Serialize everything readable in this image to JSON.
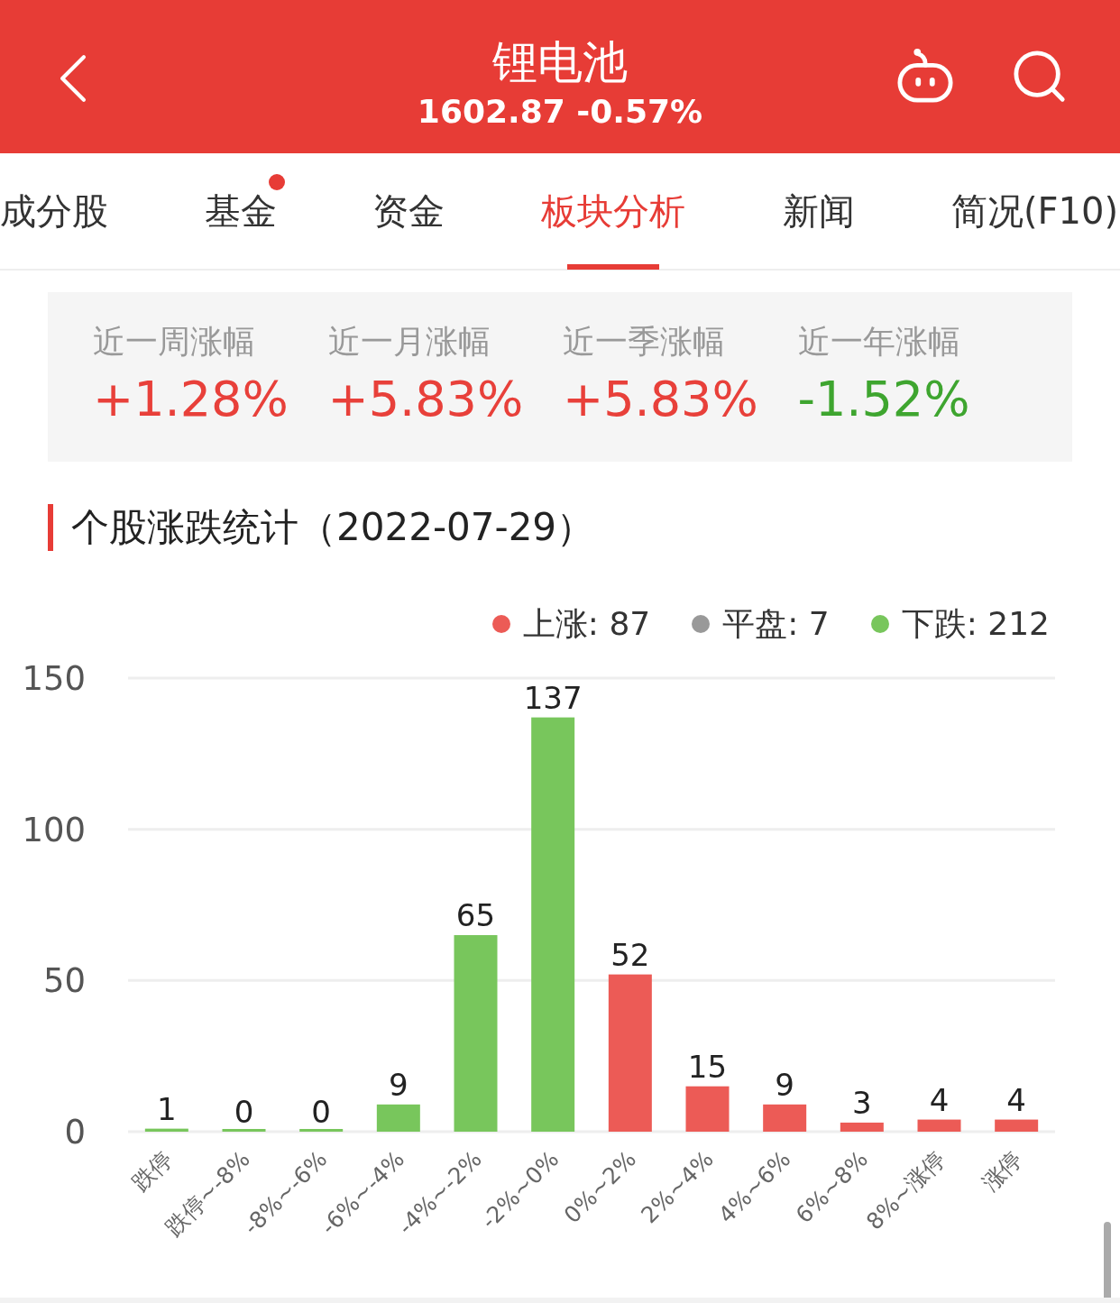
{
  "header": {
    "title": "锂电池",
    "quote": "1602.87 -0.57%"
  },
  "tabs": [
    {
      "label": "成分股",
      "selected": false,
      "badge": false
    },
    {
      "label": "基金",
      "selected": false,
      "badge": true
    },
    {
      "label": "资金",
      "selected": false,
      "badge": false
    },
    {
      "label": "板块分析",
      "selected": true,
      "badge": false
    },
    {
      "label": "新闻",
      "selected": false,
      "badge": false
    },
    {
      "label": "简况(F10)",
      "selected": false,
      "badge": false
    }
  ],
  "stats": [
    {
      "label": "近一周涨幅",
      "value": "+1.28%",
      "color": "#e8403a"
    },
    {
      "label": "近一月涨幅",
      "value": "+5.83%",
      "color": "#e8403a"
    },
    {
      "label": "近一季涨幅",
      "value": "+5.83%",
      "color": "#e8403a"
    },
    {
      "label": "近一年涨幅",
      "value": "-1.52%",
      "color": "#3ea52f"
    }
  ],
  "section": {
    "title": "个股涨跌统计（2022-07-29）"
  },
  "legend": [
    {
      "label": "上涨: 87",
      "color": "#ec5b56"
    },
    {
      "label": "平盘: 7",
      "color": "#999999"
    },
    {
      "label": "下跌: 212",
      "color": "#78c65c"
    }
  ],
  "chart_data": {
    "type": "bar",
    "stacked": true,
    "data_labels": true,
    "ylim": [
      0,
      150
    ],
    "yticks": [
      0,
      50,
      100,
      150
    ],
    "categories": [
      "跌停",
      "跌停~-8%",
      "-8%~-6%",
      "-6%~-4%",
      "-4%~-2%",
      "-2%~0%",
      "0%~2%",
      "2%~4%",
      "4%~6%",
      "6%~8%",
      "8%~涨停",
      "涨停"
    ],
    "series": [
      {
        "color": "#78c65c",
        "values": [
          1,
          0,
          0,
          9,
          65,
          137,
          null,
          null,
          null,
          null,
          null,
          null
        ]
      },
      {
        "color": "#ec5b56",
        "values": [
          null,
          null,
          null,
          null,
          null,
          null,
          52,
          15,
          9,
          3,
          4,
          4
        ]
      }
    ]
  }
}
